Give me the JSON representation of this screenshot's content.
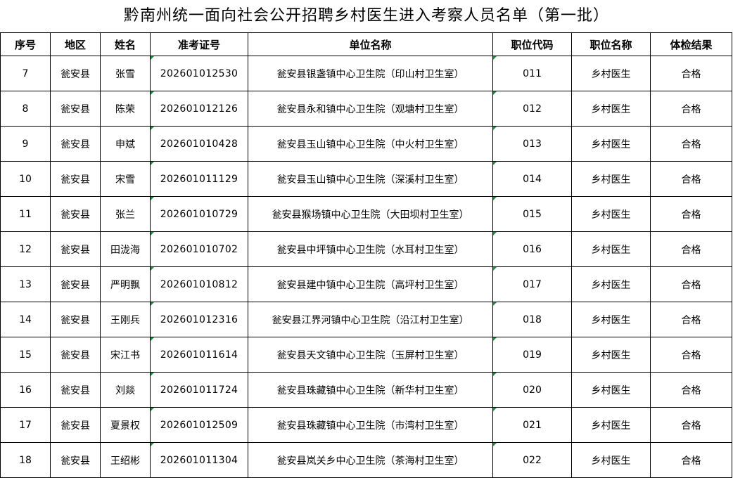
{
  "title": "黔南州统一面向社会公开招聘乡村医生进入考察人员名单（第一批）",
  "columns": [
    "序号",
    "地区",
    "姓名",
    "准考证号",
    "单位名称",
    "职位代码",
    "职位名称",
    "体检结果"
  ],
  "rows": [
    [
      "7",
      "瓮安县",
      "张雪",
      "202601012530",
      "瓮安县银盏镇中心卫生院（印山村卫生室）",
      "011",
      "乡村医生",
      "合格"
    ],
    [
      "8",
      "瓮安县",
      "陈荣",
      "202601012126",
      "瓮安县永和镇中心卫生院（观塘村卫生室）",
      "012",
      "乡村医生",
      "合格"
    ],
    [
      "9",
      "瓮安县",
      "申斌",
      "202601010428",
      "瓮安县玉山镇中心卫生院（中火村卫生室）",
      "013",
      "乡村医生",
      "合格"
    ],
    [
      "10",
      "瓮安县",
      "宋雪",
      "202601011129",
      "瓮安县玉山镇中心卫生院（深溪村卫生室）",
      "014",
      "乡村医生",
      "合格"
    ],
    [
      "11",
      "瓮安县",
      "张兰",
      "202601010729",
      "瓮安县猴场镇中心卫生院（大田坝村卫生室）",
      "015",
      "乡村医生",
      "合格"
    ],
    [
      "12",
      "瓮安县",
      "田泷海",
      "202601010702",
      "瓮安县中坪镇中心卫生院（水耳村卫生室）",
      "016",
      "乡村医生",
      "合格"
    ],
    [
      "13",
      "瓮安县",
      "严明飘",
      "202601010812",
      "瓮安县建中镇中心卫生院（高坪村卫生室）",
      "017",
      "乡村医生",
      "合格"
    ],
    [
      "14",
      "瓮安县",
      "王刚兵",
      "202601012316",
      "瓮安县江界河镇中心卫生院（沿江村卫生室）",
      "018",
      "乡村医生",
      "合格"
    ],
    [
      "15",
      "瓮安县",
      "宋江书",
      "202601011614",
      "瓮安县天文镇中心卫生院（玉屏村卫生室）",
      "019",
      "乡村医生",
      "合格"
    ],
    [
      "16",
      "瓮安县",
      "刘燚",
      "202601011724",
      "瓮安县珠藏镇中心卫生院（新华村卫生室）",
      "020",
      "乡村医生",
      "合格"
    ],
    [
      "17",
      "瓮安县",
      "夏景权",
      "202601012509",
      "瓮安县珠藏镇中心卫生院（市湾村卫生室）",
      "021",
      "乡村医生",
      "合格"
    ],
    [
      "18",
      "瓮安县",
      "王绍彬",
      "202601011304",
      "瓮安县岚关乡中心卫生院（茶海村卫生室）",
      "022",
      "乡村医生",
      "合格"
    ]
  ],
  "marker_color": "#1e8a3c"
}
